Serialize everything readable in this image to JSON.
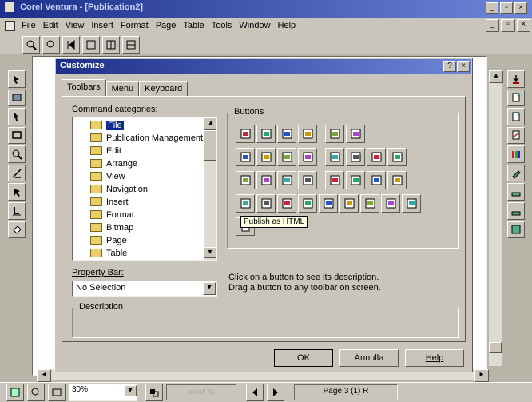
{
  "app": {
    "title": "Corel Ventura - [Publication2]",
    "menu": [
      "File",
      "Edit",
      "View",
      "Insert",
      "Format",
      "Page",
      "Table",
      "Tools",
      "Window",
      "Help"
    ]
  },
  "dialog": {
    "title": "Customize",
    "tabs": [
      "Toolbars",
      "Menu",
      "Keyboard"
    ],
    "active_tab": "Toolbars",
    "command_categories_label": "Command categories:",
    "categories": [
      "File",
      "Publication Management",
      "Edit",
      "Arrange",
      "View",
      "Navigation",
      "Insert",
      "Format",
      "Bitmap",
      "Page",
      "Table"
    ],
    "selected_category": "File",
    "buttons_group_label": "Buttons",
    "tooltip": "Publish as HTML",
    "property_bar_label": "Property Bar:",
    "property_bar_value": "No Selection",
    "hint_line1": "Click on a button to see its description.",
    "hint_line2": "Drag a button to any toolbar on screen.",
    "description_label": "Description",
    "ok": "OK",
    "cancel": "Annulla",
    "help": "Help"
  },
  "statusbar": {
    "zoom": "30%",
    "page": "Page 3 (1) R",
    "faded": "annul tip"
  },
  "colors": {
    "title_start": "#1c2f8a",
    "title_end": "#6e86d8",
    "selection": "#0a2b8a",
    "face": "#c9c5bb"
  },
  "icons": {
    "buttons_row1": [
      "new-doc-icon",
      "new-blank-icon",
      "open-icon",
      "open-folder-icon",
      "import-icon",
      "export-icon"
    ],
    "buttons_row2": [
      "save-icon",
      "save-all-icon",
      "close-doc-icon",
      "save-as-icon",
      "print-icon",
      "print-setup-icon",
      "print-preview-icon",
      "send-icon"
    ],
    "buttons_row3": [
      "copy-page-icon",
      "duplicate-icon",
      "page-setup-icon",
      "publish-icon",
      "mail-icon",
      "mail-recipient-icon",
      "revert-icon",
      "acquire-icon"
    ],
    "buttons_row4": [
      "globe-icon",
      "acrobat-icon",
      "web-icon",
      "html-icon",
      "print-merge-icon",
      "label-icon",
      "preview-icon",
      "printer-icon",
      "scanner-icon"
    ],
    "buttons_row5": [
      "publish-html-icon"
    ]
  }
}
